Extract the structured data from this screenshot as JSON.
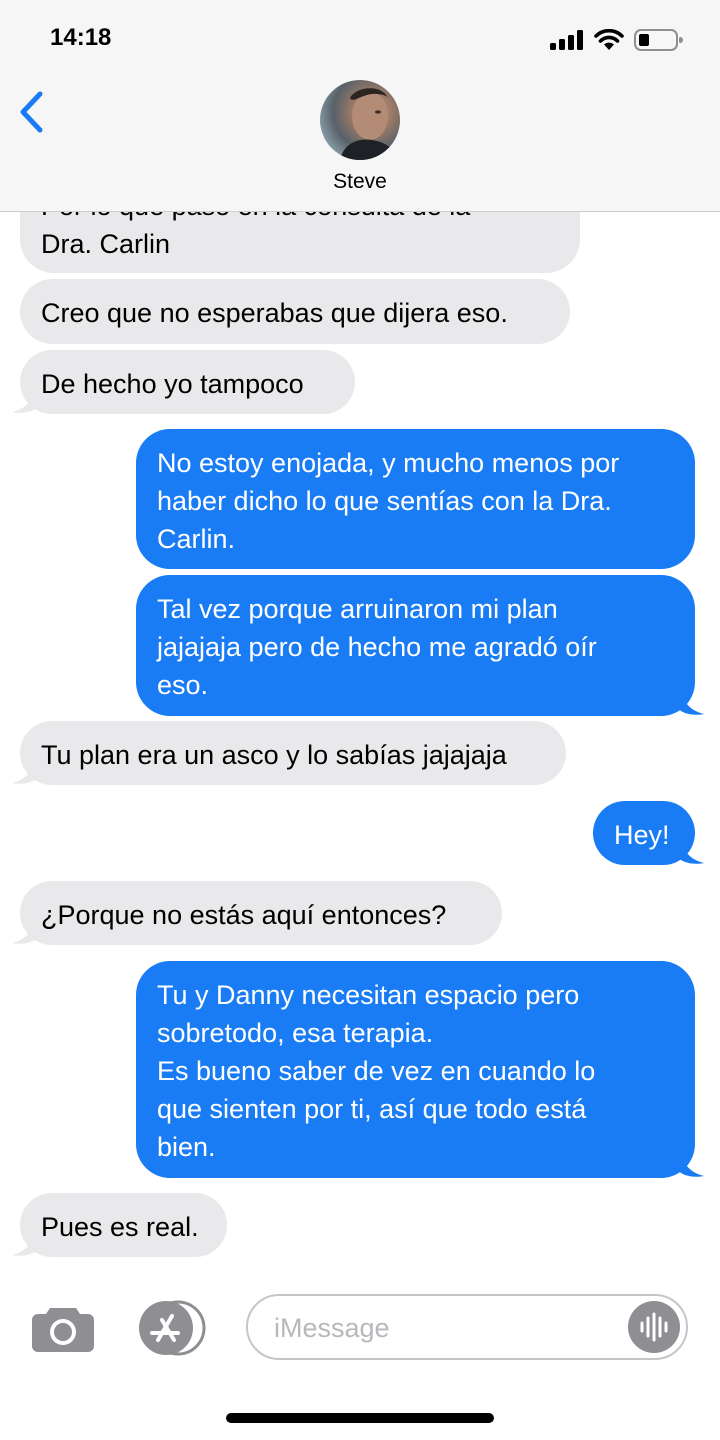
{
  "status_bar": {
    "time": "14:18"
  },
  "header": {
    "contact_name": "Steve"
  },
  "messages": [
    {
      "from": "contact",
      "text": "Por lo que pasó en la consulta de la\nDra. Carlin"
    },
    {
      "from": "contact",
      "text": "Creo que no esperabas que dijera eso."
    },
    {
      "from": "contact",
      "text": "De hecho yo tampoco"
    },
    {
      "from": "me",
      "text": "No estoy enojada, y mucho menos por\nhaber dicho lo que sentías con la Dra.\nCarlin."
    },
    {
      "from": "me",
      "text": "Tal vez porque arruinaron mi plan\njajajaja pero de hecho me agradó oír\neso."
    },
    {
      "from": "contact",
      "text": "Tu plan era un asco y lo sabías jajajaja"
    },
    {
      "from": "me",
      "text": "Hey!"
    },
    {
      "from": "contact",
      "text": "¿Porque no estás aquí entonces?"
    },
    {
      "from": "me",
      "text": "Tu y Danny necesitan espacio pero\nsobretodo, esa terapia.\nEs bueno saber de vez en cuando lo\nque sienten por ti, así que todo está\nbien."
    },
    {
      "from": "contact",
      "text": "Pues es real."
    }
  ],
  "input_bar": {
    "placeholder": "iMessage"
  },
  "colors": {
    "sent_bubble": "#1a7cf5",
    "received_bubble": "#e9e9eb",
    "accent": "#1a7cf5"
  },
  "icons": [
    "chevron-left-icon",
    "camera-icon",
    "appstore-icon",
    "audio-waveform-icon",
    "signal-icon",
    "wifi-icon",
    "battery-icon"
  ]
}
